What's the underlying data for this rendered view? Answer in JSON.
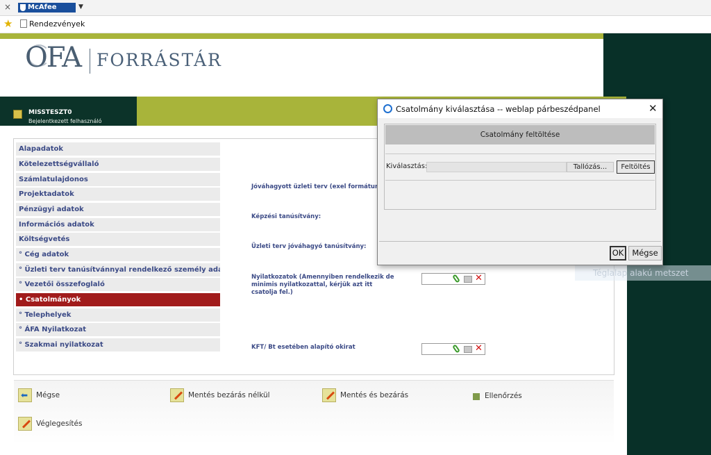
{
  "browser": {
    "mcafee_label": "McAfee",
    "favorites": {
      "item_label": "Rendezvények"
    }
  },
  "header": {
    "logo_ofa": "OFA",
    "logo_forras": "FORRÁSTÁR",
    "user_name": "MISSTESZT0",
    "user_role": "Bejelentkezett felhasználó"
  },
  "sidebar": {
    "items": [
      {
        "label": "Alapadatok"
      },
      {
        "label": "Kötelezettségvállaló"
      },
      {
        "label": "Számlatulajdonos"
      },
      {
        "label": "Projektadatok"
      },
      {
        "label": "Pénzügyi adatok"
      },
      {
        "label": "Információs adatok"
      },
      {
        "label": "Költségvetés"
      },
      {
        "label": "° Cég adatok"
      },
      {
        "label": "° Üzleti terv tanúsítvánnyal rendelkező személy adatai"
      },
      {
        "label": "° Vezetői összefoglaló"
      },
      {
        "label": "• Csatolmányok"
      },
      {
        "label": "° Telephelyek"
      },
      {
        "label": "° ÁFA Nyilatkozat"
      },
      {
        "label": "° Szakmai nyilatkozat"
      }
    ],
    "active_index": 10
  },
  "form": {
    "fields": [
      {
        "label": "Jóváhagyott üzleti terv (exel formátum"
      },
      {
        "label": "Képzési tanúsítvány:"
      },
      {
        "label": "Üzleti terv jóváhagyó tanúsítvány:"
      },
      {
        "label": "Nyilatkozatok (Amennyiben rendelkezik de minimis nyilatkozattal, kérjük azt itt csatolja fel.)"
      },
      {
        "label": "KFT/ Bt esetében alapító okirat"
      }
    ]
  },
  "toolbar": {
    "cancel_label": "Mégse",
    "save_no_close_label": "Mentés bezárás nélkül",
    "save_close_label": "Mentés és bezárás",
    "check_label": "Ellenőrzés",
    "finalize_label": "Véglegesítés"
  },
  "background_hint": "Téglalap alakú metszet",
  "dialog": {
    "title": "Csatolmány kiválasztása -- weblap párbeszédpanel",
    "header": "Csatolmány feltöltése",
    "select_label": "Kiválasztás:",
    "browse_label": "Tallózás...",
    "upload_label": "Feltöltés",
    "ok_label": "OK",
    "cancel_label": "Mégse"
  }
}
